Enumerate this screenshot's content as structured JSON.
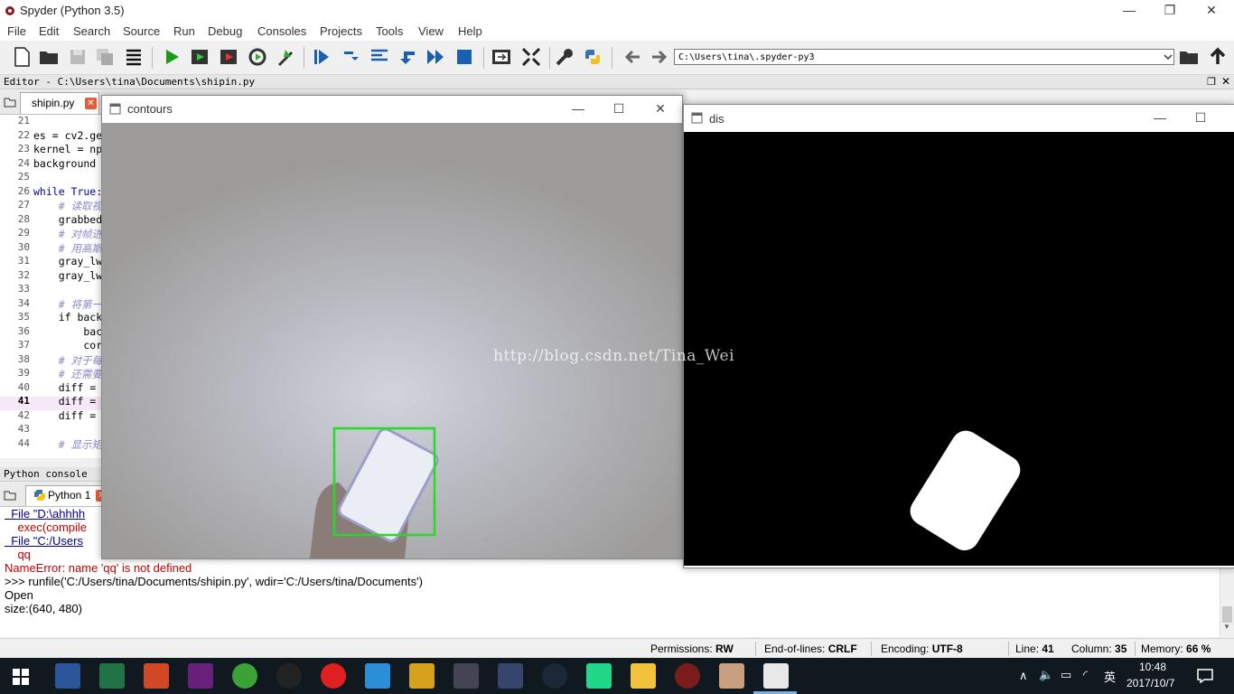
{
  "app": {
    "title": "Spyder (Python 3.5)"
  },
  "menu": [
    "File",
    "Edit",
    "Search",
    "Source",
    "Run",
    "Debug",
    "Consoles",
    "Projects",
    "Tools",
    "View",
    "Help"
  ],
  "toolbar": {
    "working_dir": "C:\\Users\\tina\\.spyder-py3"
  },
  "editor": {
    "header": "Editor - C:\\Users\\tina\\Documents\\shipin.py",
    "tab": "shipin.py",
    "current_line": 41,
    "lines": [
      {
        "n": "21",
        "text": "",
        "cls": ""
      },
      {
        "n": "22",
        "text": "es = cv2.ge",
        "cls": ""
      },
      {
        "n": "23",
        "text": "kernel = np",
        "cls": ""
      },
      {
        "n": "24",
        "text": "background",
        "cls": ""
      },
      {
        "n": "25",
        "text": "",
        "cls": ""
      },
      {
        "n": "26",
        "text": "while True:",
        "cls": "kw"
      },
      {
        "n": "27",
        "text": "    # 读取视",
        "cls": "cmt"
      },
      {
        "n": "28",
        "text": "    grabbed",
        "cls": ""
      },
      {
        "n": "29",
        "text": "    # 对帧进",
        "cls": "cmt"
      },
      {
        "n": "30",
        "text": "    # 用高斯",
        "cls": "cmt"
      },
      {
        "n": "31",
        "text": "    gray_lw",
        "cls": ""
      },
      {
        "n": "32",
        "text": "    gray_lw",
        "cls": ""
      },
      {
        "n": "33",
        "text": "",
        "cls": ""
      },
      {
        "n": "34",
        "text": "    # 将第一",
        "cls": "cmt"
      },
      {
        "n": "35",
        "text": "    if back",
        "cls": ""
      },
      {
        "n": "36",
        "text": "        bac",
        "cls": ""
      },
      {
        "n": "37",
        "text": "        cor",
        "cls": ""
      },
      {
        "n": "38",
        "text": "    # 对于每",
        "cls": "cmt"
      },
      {
        "n": "39",
        "text": "    # 还需要",
        "cls": "cmt"
      },
      {
        "n": "40",
        "text": "    diff =",
        "cls": ""
      },
      {
        "n": "41",
        "text": "    diff =",
        "cls": ""
      },
      {
        "n": "42",
        "text": "    diff =",
        "cls": ""
      },
      {
        "n": "43",
        "text": "",
        "cls": ""
      },
      {
        "n": "44",
        "text": "    # 显示矩",
        "cls": "cmt"
      }
    ]
  },
  "console": {
    "header": "Python console",
    "tab": "Python 1",
    "lines": [
      {
        "text": "  File \"D:\\ahhhh",
        "cls": "blue"
      },
      {
        "text": "    exec(compile",
        "cls": "red"
      },
      {
        "text": "  File \"C:/Users",
        "cls": "blue"
      },
      {
        "text": "    qq",
        "cls": "red"
      },
      {
        "text": "NameError: name 'qq' is not defined",
        "cls": "red"
      },
      {
        "text": ">>> runfile('C:/Users/tina/Documents/shipin.py', wdir='C:/Users/tina/Documents')",
        "cls": ""
      },
      {
        "text": "Open",
        "cls": ""
      },
      {
        "text": "size:(640, 480)",
        "cls": ""
      }
    ]
  },
  "status": {
    "permissions_label": "Permissions:",
    "permissions_value": "RW",
    "eol_label": "End-of-lines:",
    "eol_value": "CRLF",
    "encoding_label": "Encoding:",
    "encoding_value": "UTF-8",
    "line_label": "Line:",
    "line_value": "41",
    "column_label": "Column:",
    "column_value": "35",
    "memory_label": "Memory:",
    "memory_value": "66 %"
  },
  "windows": {
    "contours_title": "contours",
    "dis_title": "dis"
  },
  "watermark": "http://blog.csdn.net/Tina_Wei",
  "taskbar": {
    "time": "10:48",
    "date": "2017/10/7",
    "ime": "英"
  },
  "colors": {
    "bbox_green": "#22dd22",
    "taskbar_bg": "#101820"
  }
}
